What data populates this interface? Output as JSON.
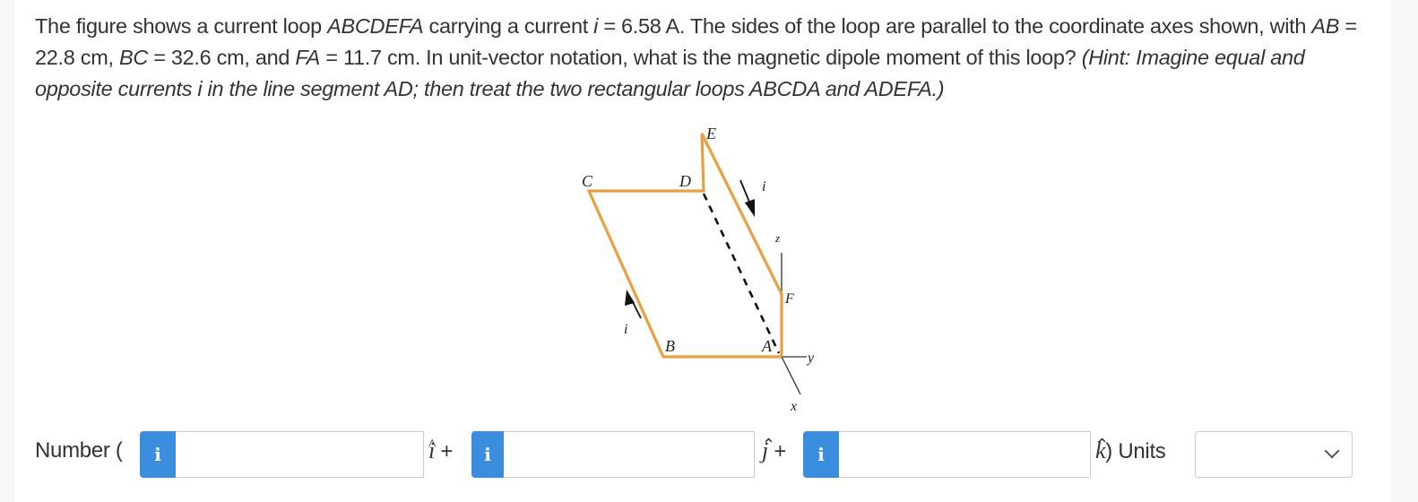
{
  "question": {
    "parts": [
      {
        "t": "The figure shows a current loop ",
        "i": false
      },
      {
        "t": "ABCDEFA",
        "i": true
      },
      {
        "t": " carrying a current ",
        "i": false
      },
      {
        "t": "i",
        "i": true
      },
      {
        "t": " = 6.58 A. The sides of the loop are parallel to the coordinate axes shown, with ",
        "i": false
      },
      {
        "t": "AB",
        "i": true
      },
      {
        "t": " = 22.8 cm, ",
        "i": false
      },
      {
        "t": "BC",
        "i": true
      },
      {
        "t": " = 32.6 cm, and ",
        "i": false
      },
      {
        "t": "FA",
        "i": true
      },
      {
        "t": " = 11.7 cm. In unit-vector notation, what is the magnetic dipole moment of this loop? ",
        "i": false
      },
      {
        "t": "(Hint: Imagine equal and opposite currents i in the line segment AD; then treat the two rectangular loops ABCDA and ADEFA.)",
        "i": true
      }
    ],
    "current": "6.58 A",
    "AB": "22.8 cm",
    "BC": "32.6 cm",
    "FA": "11.7 cm"
  },
  "figure": {
    "labels": {
      "A": "A",
      "B": "B",
      "C": "C",
      "D": "D",
      "E": "E",
      "F": "F",
      "i_top": "i",
      "i_left": "i",
      "x": "x",
      "y": "y",
      "z": "z"
    },
    "wire_color": "#e8a041"
  },
  "answer": {
    "number_label": "Number (",
    "i_hat": "i",
    "j_hat": "j",
    "k_hat": "k",
    "plus": "+",
    "close_paren": ")",
    "units_label": "Units",
    "info_glyph": "i",
    "x_value": "",
    "y_value": "",
    "z_value": "",
    "units_selected": "",
    "info_color": "#3b8ddd"
  }
}
